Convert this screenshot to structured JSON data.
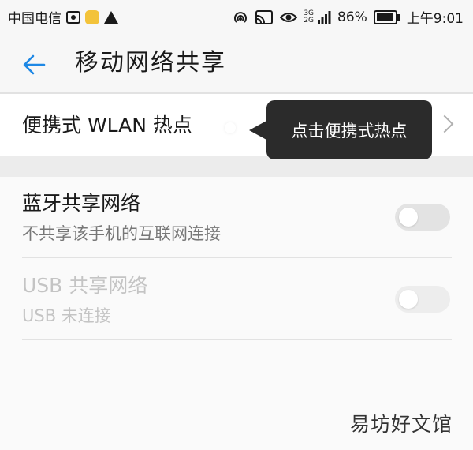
{
  "status_bar": {
    "carrier": "中国电信",
    "network": [
      "3G",
      "2G"
    ],
    "battery": "86%",
    "time": "上午9:01"
  },
  "header": {
    "title": "移动网络共享",
    "back_icon": "arrow-left-icon",
    "accent_color": "#1e88e5"
  },
  "hotspot_row": {
    "label": "便携式 WLAN 热点",
    "tooltip": "点击便携式热点"
  },
  "items": [
    {
      "title": "蓝牙共享网络",
      "subtitle": "不共享该手机的互联网连接",
      "enabled": true,
      "on": false
    },
    {
      "title": "USB 共享网络",
      "subtitle": "USB 未连接",
      "enabled": false,
      "on": false
    }
  ],
  "watermark": "易坊好文馆"
}
